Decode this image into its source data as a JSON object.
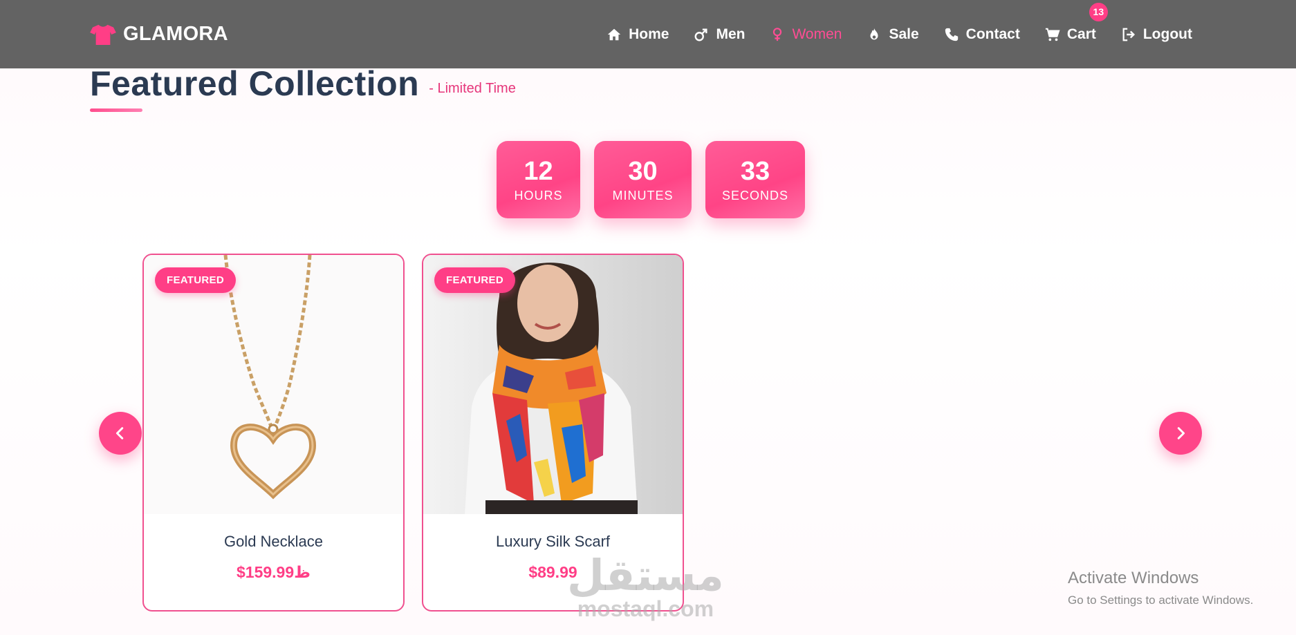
{
  "brand": {
    "name": "GLAMORA",
    "icon": "tshirt-icon",
    "color": "#ff3e86"
  },
  "nav": {
    "items": [
      {
        "label": "Home",
        "icon": "home-icon"
      },
      {
        "label": "Men",
        "icon": "male-icon"
      },
      {
        "label": "Women",
        "icon": "female-icon",
        "active": true
      },
      {
        "label": "Sale",
        "icon": "fire-icon"
      },
      {
        "label": "Contact",
        "icon": "phone-icon"
      },
      {
        "label": "Cart",
        "icon": "cart-icon",
        "badge": "13"
      },
      {
        "label": "Logout",
        "icon": "logout-icon"
      }
    ]
  },
  "section": {
    "title": "Featured Collection",
    "subtitle": "- Limited Time"
  },
  "countdown": {
    "hours": {
      "value": "12",
      "label": "HOURS"
    },
    "minutes": {
      "value": "30",
      "label": "MINUTES"
    },
    "seconds": {
      "value": "33",
      "label": "SECONDS"
    }
  },
  "carousel": {
    "prev_icon": "chevron-left-icon",
    "next_icon": "chevron-right-icon",
    "products": [
      {
        "badge": "FEATURED",
        "name": "Gold Necklace",
        "price": "$159.99ظ"
      },
      {
        "badge": "FEATURED",
        "name": "Luxury Silk Scarf",
        "price": "$89.99"
      }
    ]
  },
  "watermark": {
    "arabic": "مستقل",
    "latin": "mostaql.com"
  },
  "windows_activation": {
    "title": "Activate Windows",
    "subtitle": "Go to Settings to activate Windows."
  },
  "colors": {
    "accent": "#ff3e86",
    "navbar": "#636363",
    "heading": "#2b3a52"
  }
}
